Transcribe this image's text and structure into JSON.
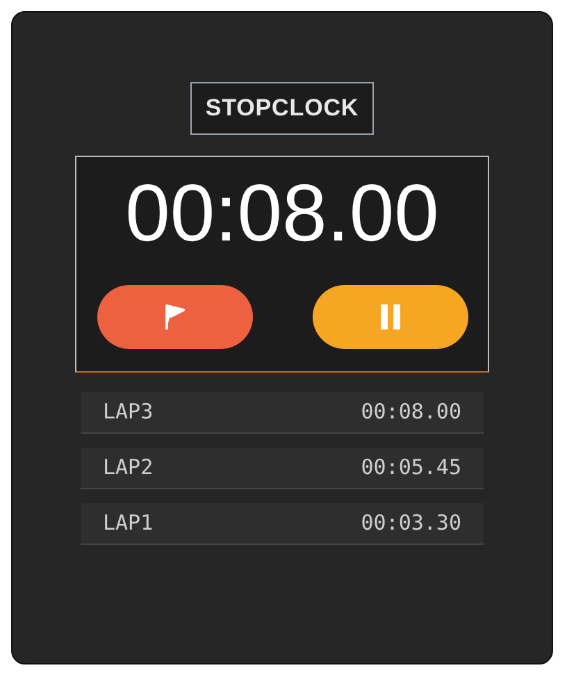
{
  "title": "STOPCLOCK",
  "display": "00:08.00",
  "buttons": [
    {
      "kind": "lap",
      "color": "#ee6140"
    },
    {
      "kind": "pause",
      "color": "#f6a623"
    }
  ],
  "laps": [
    {
      "label": "LAP3",
      "time": "00:08.00"
    },
    {
      "label": "LAP2",
      "time": "00:05.45"
    },
    {
      "label": "LAP1",
      "time": "00:03.30"
    }
  ]
}
